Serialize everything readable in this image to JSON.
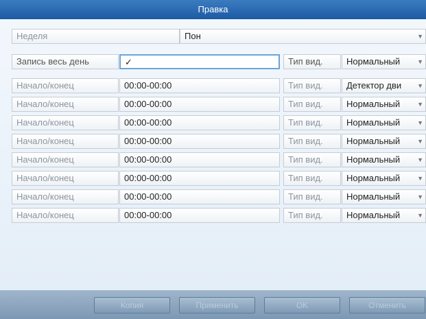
{
  "dialog": {
    "title": "Правка"
  },
  "week": {
    "label": "Неделя",
    "value": "Пон"
  },
  "allday": {
    "label": "Запись весь день",
    "checked_mark": "✓",
    "type_label": "Тип вид.",
    "type_value": "Нормальный"
  },
  "schedule_rows": [
    {
      "label": "Начало/конец",
      "time": "00:00-00:00",
      "type_label": "Тип вид.",
      "type_value": "Детектор дви"
    },
    {
      "label": "Начало/конец",
      "time": "00:00-00:00",
      "type_label": "Тип вид.",
      "type_value": "Нормальный"
    },
    {
      "label": "Начало/конец",
      "time": "00:00-00:00",
      "type_label": "Тип вид.",
      "type_value": "Нормальный"
    },
    {
      "label": "Начало/конец",
      "time": "00:00-00:00",
      "type_label": "Тип вид.",
      "type_value": "Нормальный"
    },
    {
      "label": "Начало/конец",
      "time": "00:00-00:00",
      "type_label": "Тип вид.",
      "type_value": "Нормальный"
    },
    {
      "label": "Начало/конец",
      "time": "00:00-00:00",
      "type_label": "Тип вид.",
      "type_value": "Нормальный"
    },
    {
      "label": "Начало/конец",
      "time": "00:00-00:00",
      "type_label": "Тип вид.",
      "type_value": "Нормальный"
    },
    {
      "label": "Начало/конец",
      "time": "00:00-00:00",
      "type_label": "Тип вид.",
      "type_value": "Нормальный"
    }
  ],
  "buttons": {
    "copy": "Копия",
    "apply": "Применить",
    "ok": "OK",
    "cancel": "Отменить"
  },
  "icons": {
    "dropdown": "chevron-down-icon",
    "check": "checkmark-icon"
  },
  "colors": {
    "title_bar": "#2a6db5",
    "footer": "#8aa4be",
    "focus_border": "#6aa4d9"
  }
}
